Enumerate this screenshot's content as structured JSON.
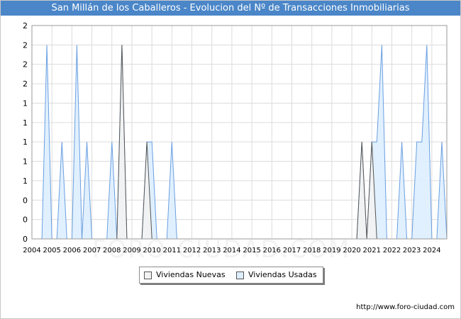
{
  "header": {
    "title": "San Millán de los Caballeros - Evolucion del Nº de Transacciones Inmobiliarias"
  },
  "watermark": "FORO-CIUDAD.COM",
  "credit": "http://www.foro-ciudad.com",
  "colors": {
    "title_bg": "#4a86c8",
    "nuevas_fill": "#f2f2f2",
    "nuevas_line": "#555555",
    "usadas_fill": "#ddeeff",
    "usadas_line": "#6b9fe0",
    "grid": "#dcdcdc"
  },
  "chart_data": {
    "type": "area",
    "title": "San Millán de los Caballeros - Evolucion del Nº de Transacciones Inmobiliarias",
    "xlim": [
      2004,
      2024.75
    ],
    "ylim": [
      0,
      2.2
    ],
    "y_ticks": [
      0,
      0.2,
      0.4,
      0.6,
      0.8,
      1,
      1.2,
      1.4,
      1.6,
      1.8,
      2,
      2.2
    ],
    "y_tick_labels": [
      "0",
      "0",
      "0",
      "1",
      "1",
      "1",
      "1",
      "1",
      "2",
      "2",
      "2",
      "2"
    ],
    "x_tick_labels": [
      "2004",
      "2005",
      "2006",
      "2007",
      "2008",
      "2009",
      "2010",
      "2011",
      "2012",
      "2013",
      "2014",
      "2015",
      "2016",
      "2017",
      "2018",
      "2019",
      "2020",
      "2021",
      "2022",
      "2023",
      "2024"
    ],
    "grid": true,
    "legend_position": "bottom-center",
    "series": [
      {
        "name": "Viviendas Nuevas",
        "points": [
          [
            2004,
            0
          ],
          [
            2008.25,
            0
          ],
          [
            2008.5,
            2
          ],
          [
            2008.75,
            0
          ],
          [
            2009.5,
            0
          ],
          [
            2009.75,
            1
          ],
          [
            2010,
            0
          ],
          [
            2020.25,
            0
          ],
          [
            2020.5,
            1
          ],
          [
            2020.75,
            0
          ],
          [
            2021,
            1
          ],
          [
            2021.25,
            0
          ],
          [
            2024.75,
            0
          ]
        ]
      },
      {
        "name": "Viviendas Usadas",
        "points": [
          [
            2004,
            0
          ],
          [
            2004.5,
            0
          ],
          [
            2004.75,
            2
          ],
          [
            2005,
            0
          ],
          [
            2005.25,
            0
          ],
          [
            2005.5,
            1
          ],
          [
            2005.75,
            0
          ],
          [
            2006,
            0
          ],
          [
            2006.25,
            2
          ],
          [
            2006.5,
            0
          ],
          [
            2006.75,
            1
          ],
          [
            2007,
            0
          ],
          [
            2007.75,
            0
          ],
          [
            2008,
            1
          ],
          [
            2008.25,
            0
          ],
          [
            2008.5,
            2
          ],
          [
            2008.75,
            0
          ],
          [
            2009.5,
            0
          ],
          [
            2009.75,
            1
          ],
          [
            2010,
            1
          ],
          [
            2010.25,
            0
          ],
          [
            2010.75,
            0
          ],
          [
            2011,
            1
          ],
          [
            2011.25,
            0
          ],
          [
            2020.25,
            0
          ],
          [
            2020.5,
            1
          ],
          [
            2020.75,
            0
          ],
          [
            2021,
            1
          ],
          [
            2021.25,
            1
          ],
          [
            2021.5,
            2
          ],
          [
            2021.75,
            0
          ],
          [
            2022.25,
            0
          ],
          [
            2022.5,
            1
          ],
          [
            2022.75,
            0
          ],
          [
            2023,
            0
          ],
          [
            2023.25,
            1
          ],
          [
            2023.5,
            1
          ],
          [
            2023.75,
            2
          ],
          [
            2024,
            0
          ],
          [
            2024.25,
            0
          ],
          [
            2024.5,
            1
          ],
          [
            2024.75,
            0
          ]
        ]
      }
    ]
  },
  "legend": {
    "items": [
      {
        "label": "Viviendas Nuevas"
      },
      {
        "label": "Viviendas Usadas"
      }
    ]
  }
}
